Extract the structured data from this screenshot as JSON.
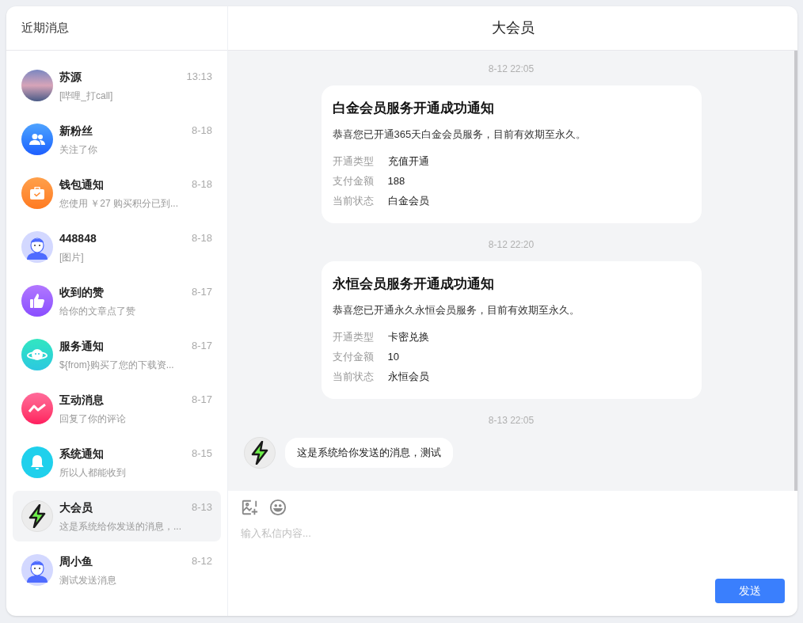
{
  "sidebar": {
    "title": "近期消息",
    "items": [
      {
        "name": "苏源",
        "time": "13:13",
        "preview": "[哔哩_打call]",
        "kind": "photo",
        "selected": false
      },
      {
        "name": "新粉丝",
        "time": "8-18",
        "preview": "关注了你",
        "kind": "followers",
        "selected": false
      },
      {
        "name": "钱包通知",
        "time": "8-18",
        "preview": "您使用 ￥27 购买积分已到...",
        "kind": "wallet",
        "selected": false
      },
      {
        "name": "448848",
        "time": "8-18",
        "preview": "[图片]",
        "kind": "cartoon",
        "selected": false
      },
      {
        "name": "收到的赞",
        "time": "8-17",
        "preview": "给你的文章点了赞",
        "kind": "like",
        "selected": false
      },
      {
        "name": "服务通知",
        "time": "8-17",
        "preview": "${from}购买了您的下载资...",
        "kind": "service",
        "selected": false
      },
      {
        "name": "互动消息",
        "time": "8-17",
        "preview": "回复了你的评论",
        "kind": "interaction",
        "selected": false
      },
      {
        "name": "系统通知",
        "time": "8-15",
        "preview": "所以人都能收到",
        "kind": "bell",
        "selected": false
      },
      {
        "name": "大会员",
        "time": "8-13",
        "preview": "这是系统给你发送的消息，...",
        "kind": "lightning",
        "selected": true
      },
      {
        "name": "周小鱼",
        "time": "8-12",
        "preview": "测试发送消息",
        "kind": "cartoon",
        "selected": false
      }
    ]
  },
  "chat": {
    "title": "大会员",
    "messages": [
      {
        "kind": "notice",
        "time": "8-12 22:05",
        "title": "白金会员服务开通成功通知",
        "text": "恭喜您已开通365天白金会员服务，目前有效期至永久。",
        "fields": [
          {
            "label": "开通类型",
            "value": "充值开通"
          },
          {
            "label": "支付金额",
            "value": "188"
          },
          {
            "label": "当前状态",
            "value": "白金会员"
          }
        ]
      },
      {
        "kind": "notice",
        "time": "8-12 22:20",
        "title": "永恒会员服务开通成功通知",
        "text": "恭喜您已开通永久永恒会员服务，目前有效期至永久。",
        "fields": [
          {
            "label": "开通类型",
            "value": "卡密兑换"
          },
          {
            "label": "支付金额",
            "value": "10"
          },
          {
            "label": "当前状态",
            "value": "永恒会员"
          }
        ]
      },
      {
        "kind": "chat",
        "time": "8-13 22:05",
        "text": "这是系统给你发送的消息，测试"
      }
    ]
  },
  "composer": {
    "placeholder": "输入私信内容...",
    "send": "发送"
  }
}
